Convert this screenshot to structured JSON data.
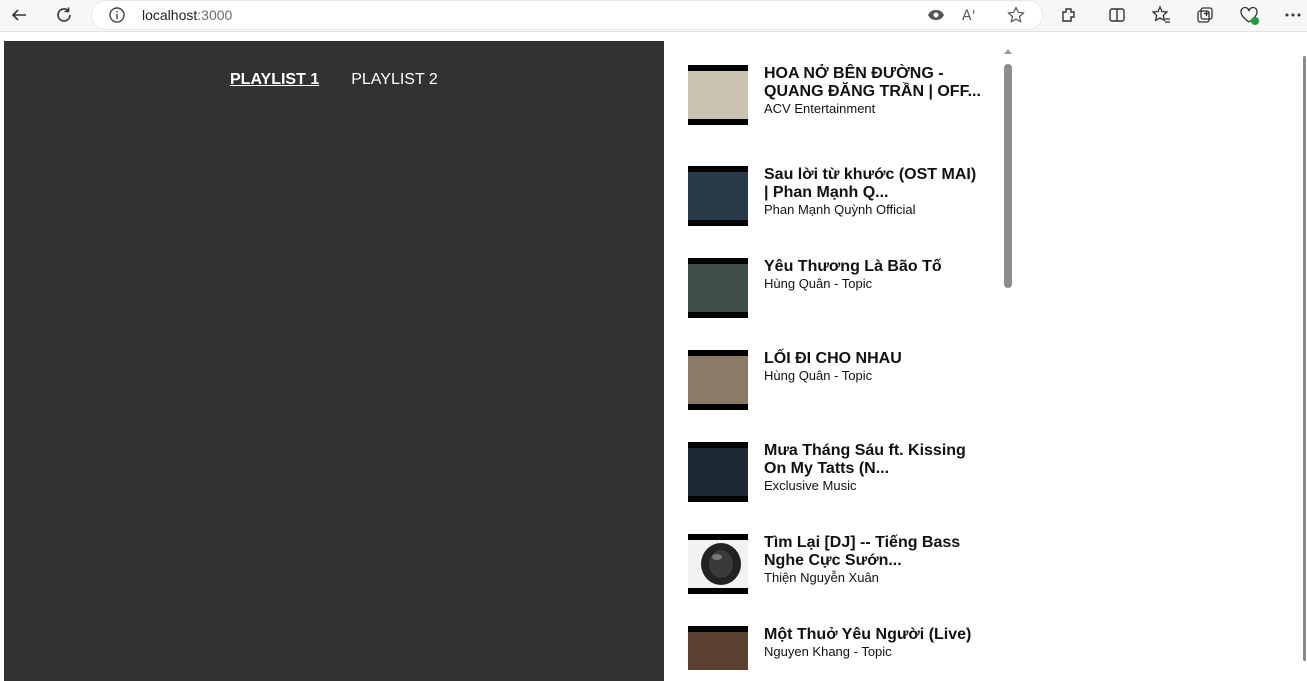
{
  "browser": {
    "url_host": "localhost",
    "url_port": ":3000"
  },
  "tabs": [
    {
      "label": "PLAYLIST 1",
      "active": true
    },
    {
      "label": "PLAYLIST 2",
      "active": false
    }
  ],
  "playlist": [
    {
      "title": "HOA NỞ BÊN ĐƯỜNG - QUANG ĐĂNG TRẦN | OFF...",
      "channel": "ACV Entertainment",
      "thumb_color": "#c9c2b3"
    },
    {
      "title": "Sau lời từ khước (OST MAI) | Phan Mạnh Q...",
      "channel": "Phan Mạnh Quỳnh Official",
      "thumb_color": "#2a3a4a"
    },
    {
      "title": "Yêu Thương Là Bão Tố",
      "channel": "Hùng Quân - Topic",
      "thumb_color": "#3f4f4a"
    },
    {
      "title": "LỐI ĐI CHO NHAU",
      "channel": "Hùng Quân - Topic",
      "thumb_color": "#8a7a66"
    },
    {
      "title": "Mưa Tháng Sáu ft. Kissing On My Tatts (N...",
      "channel": "Exclusive Music",
      "thumb_color": "#1d2a36"
    },
    {
      "title": "Tìm Lại [DJ] -- Tiếng Bass Nghe Cực Sướn...",
      "channel": "Thiện Nguyễn Xuân",
      "thumb_color": "#f2f2f2"
    },
    {
      "title": "Một Thuở Yêu Người (Live)",
      "channel": "Nguyen Khang - Topic",
      "thumb_color": "#5a4030"
    }
  ]
}
